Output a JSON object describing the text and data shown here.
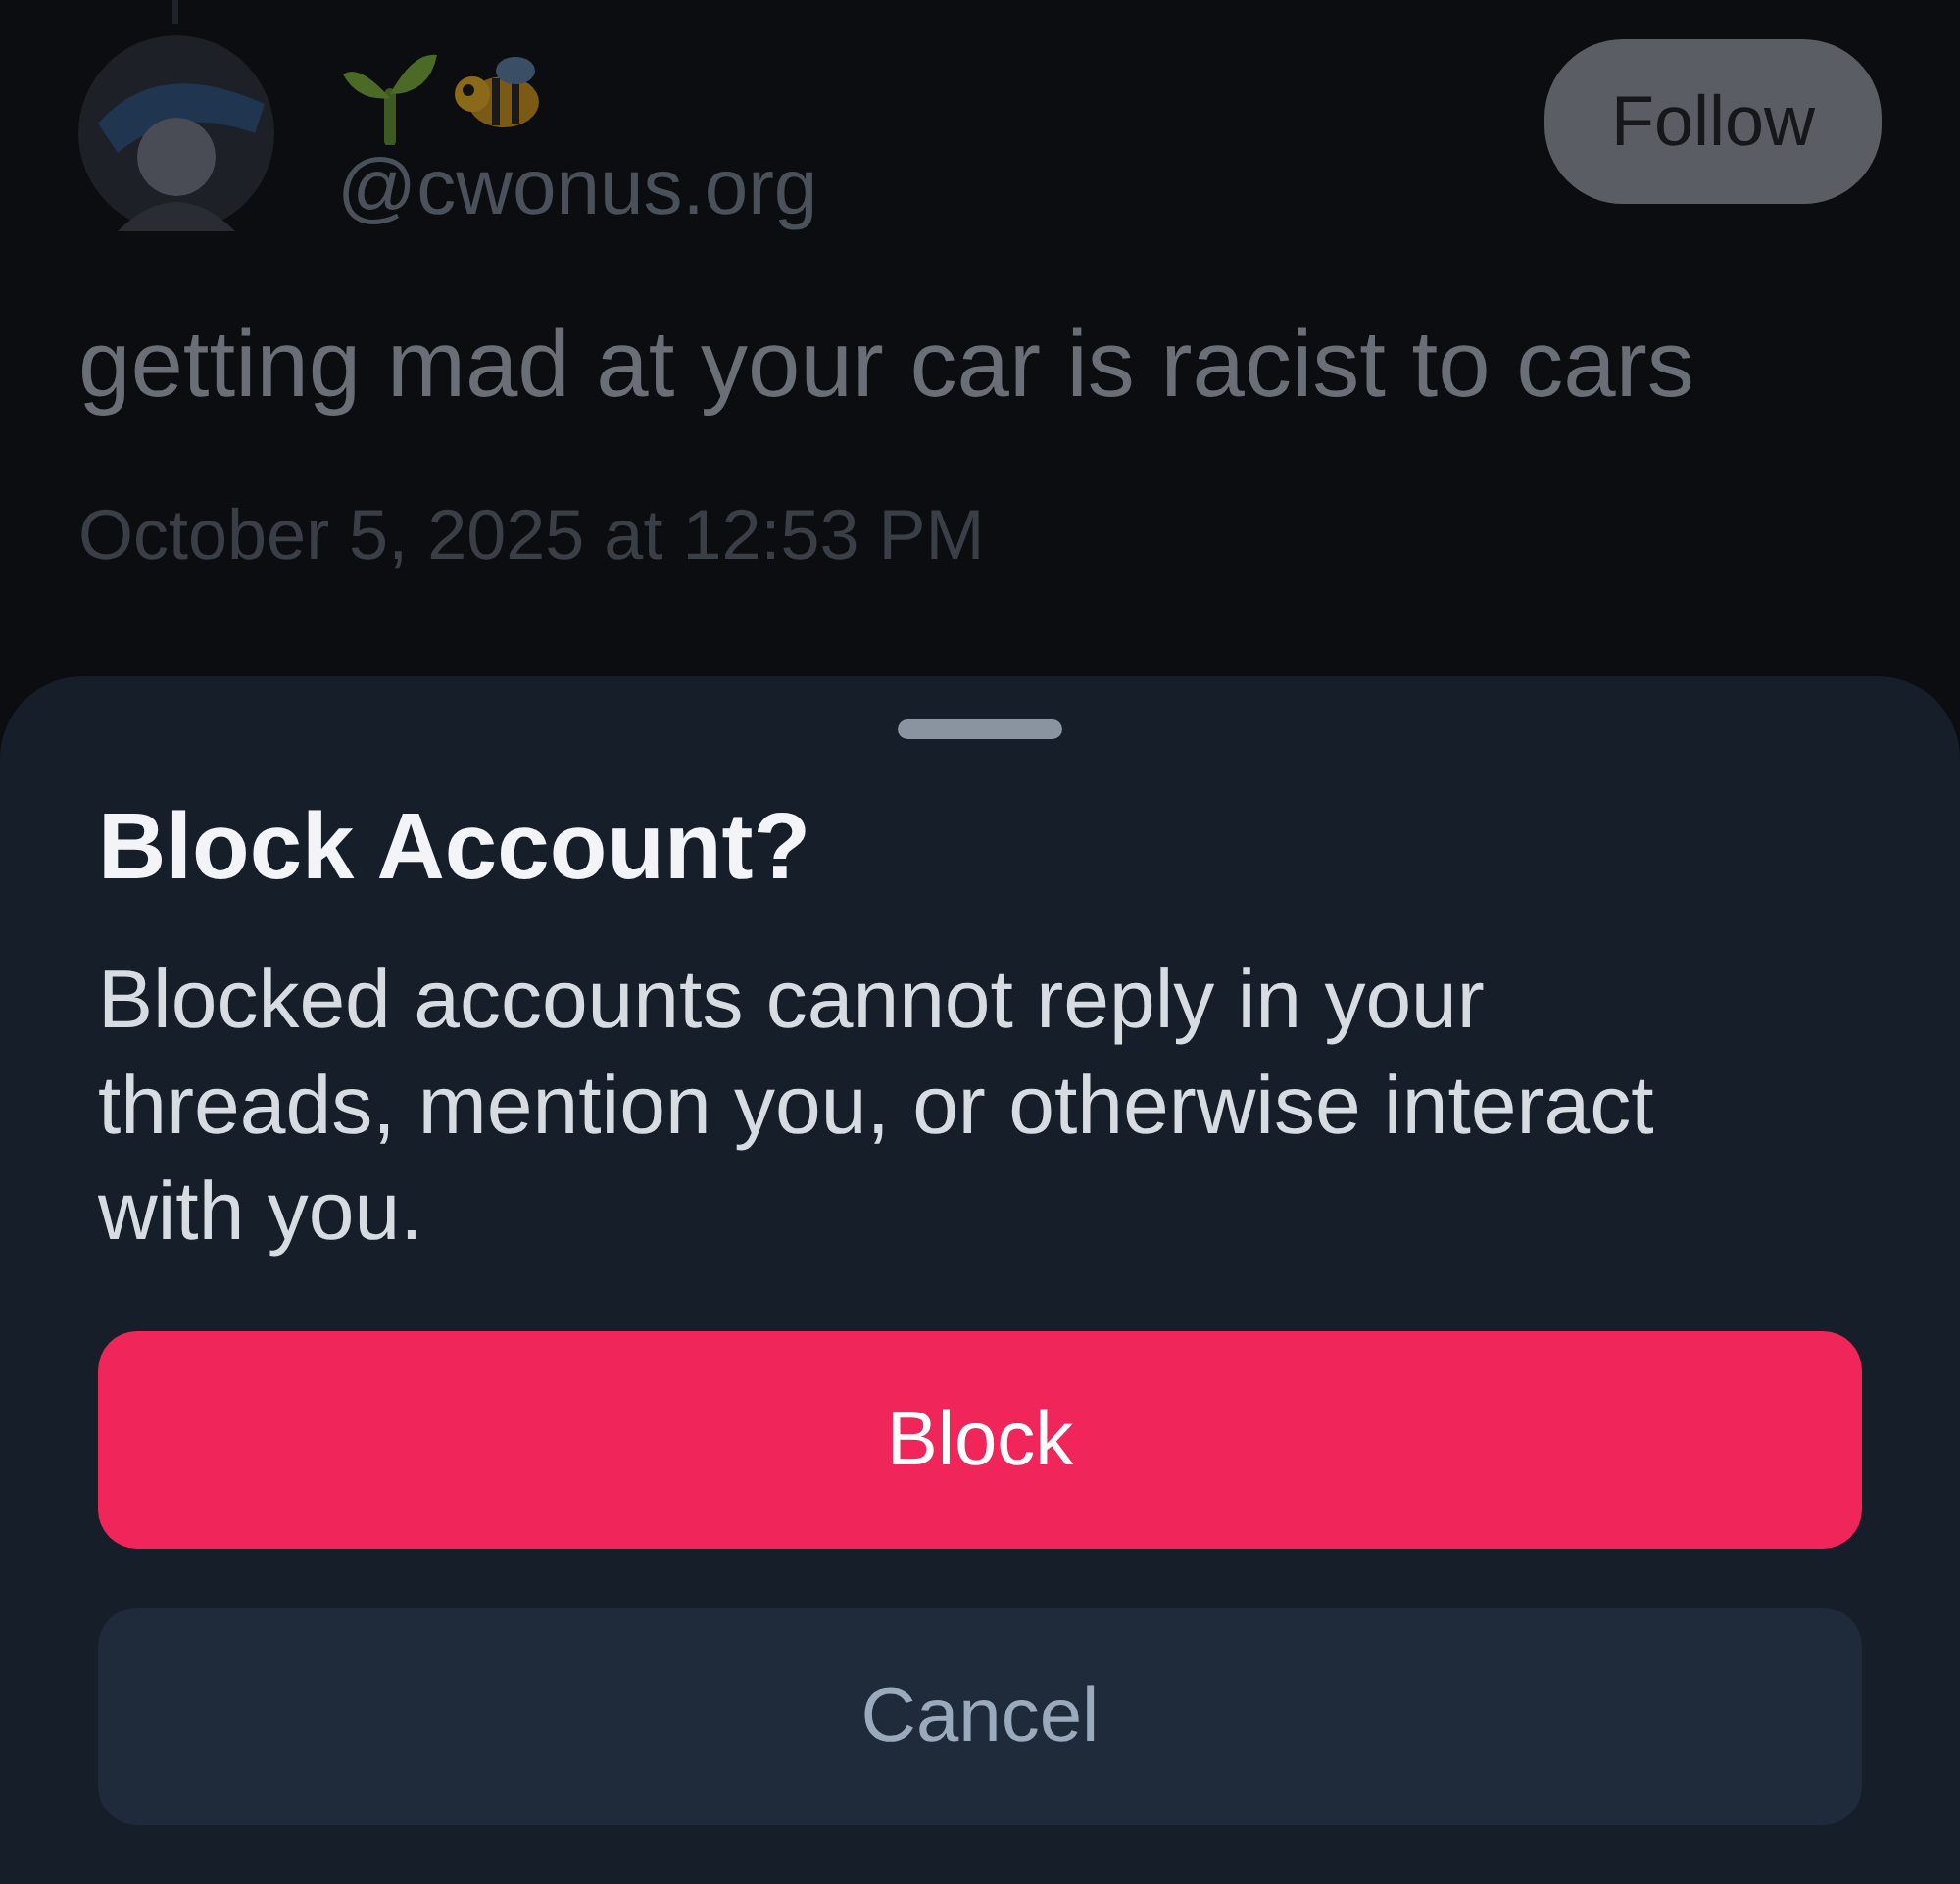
{
  "post": {
    "handle": "@cwonus.org",
    "follow_button": "Follow",
    "text": "getting mad at your car is racist to cars",
    "timestamp": "October 5, 2025 at 12:53 PM"
  },
  "sheet": {
    "title": "Block Account?",
    "message": "Blocked accounts cannot reply in your threads, mention you, or otherwise interact with you.",
    "buttons": [
      {
        "label": "Block",
        "kind": "destructive"
      },
      {
        "label": "Cancel",
        "kind": "secondary"
      }
    ]
  }
}
